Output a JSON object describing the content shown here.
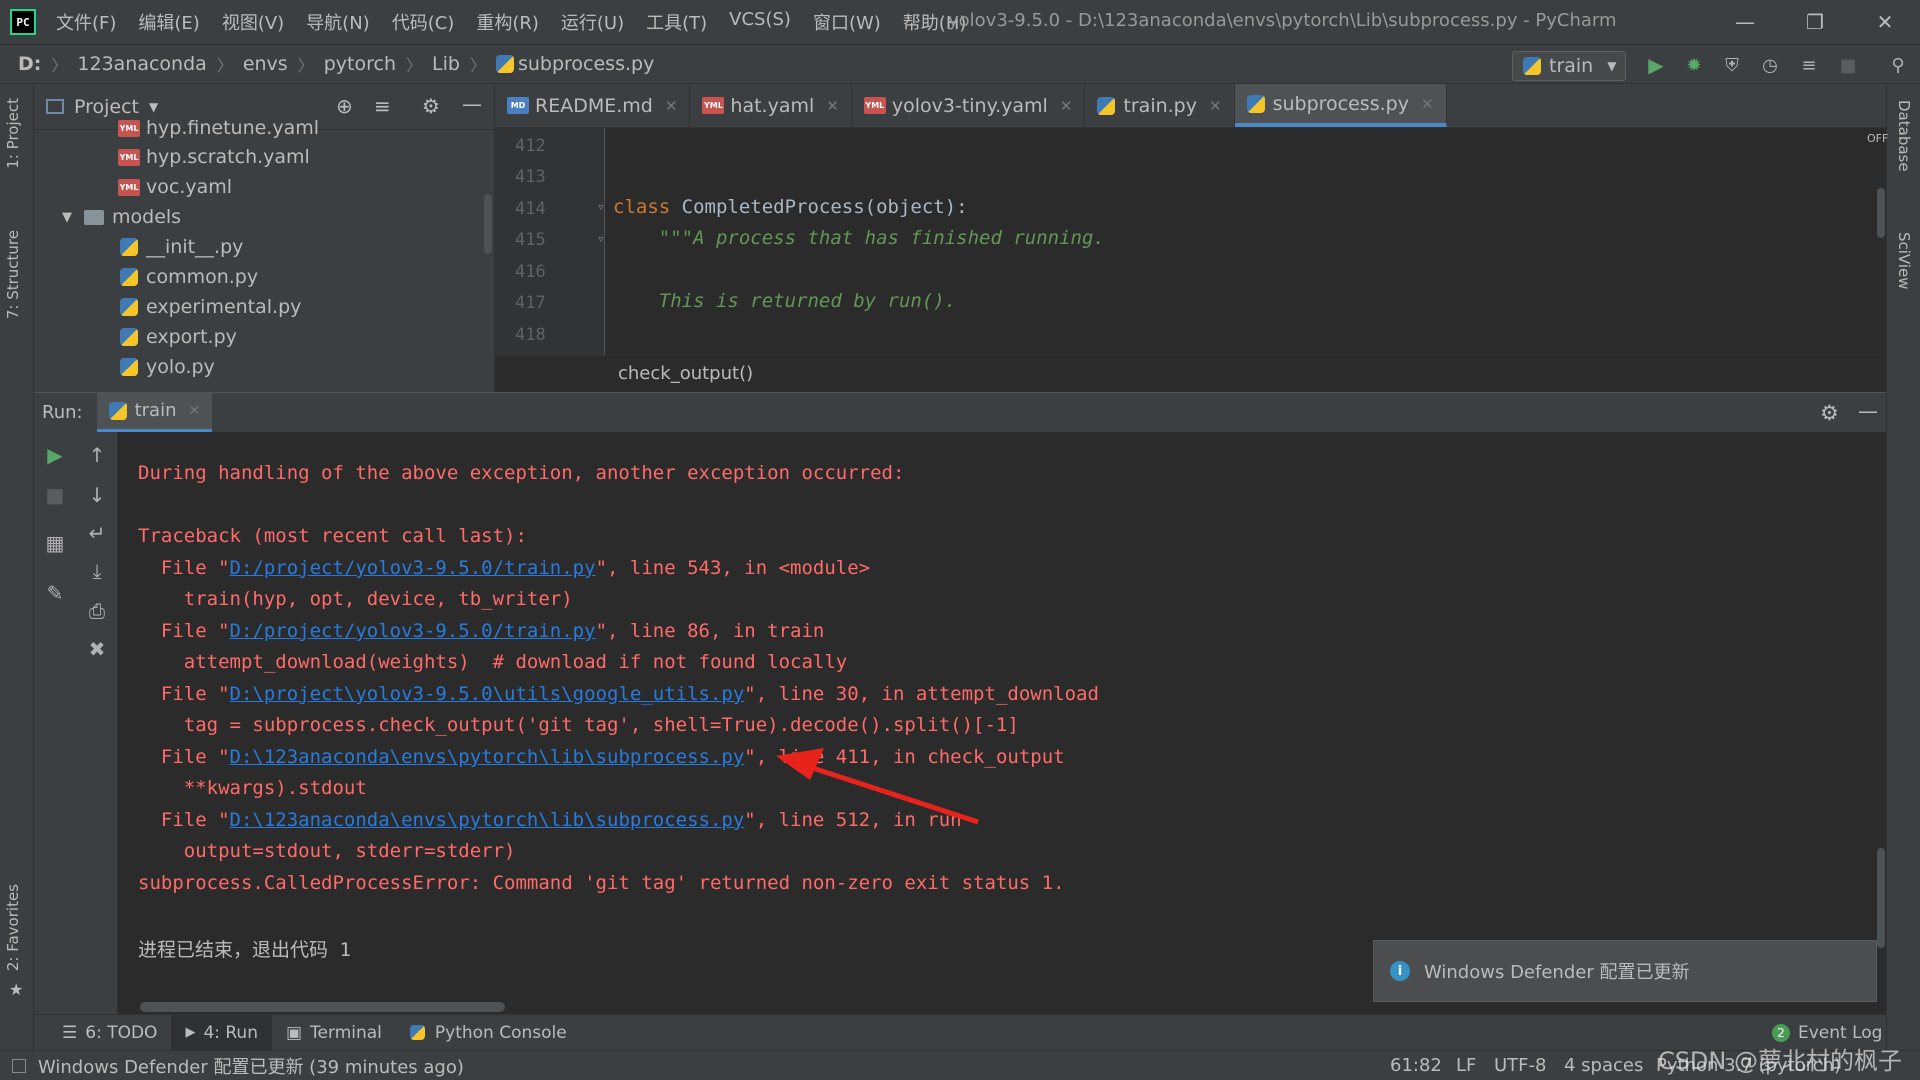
{
  "app": {
    "logo": "PC",
    "menu": [
      "文件(F)",
      "编辑(E)",
      "视图(V)",
      "导航(N)",
      "代码(C)",
      "重构(R)",
      "运行(U)",
      "工具(T)",
      "VCS(S)",
      "窗口(W)",
      "帮助(H)"
    ],
    "window_title": "yolov3-9.5.0 - D:\\123anaconda\\envs\\pytorch\\Lib\\subprocess.py - PyCharm"
  },
  "navbar": {
    "crumbs": [
      "D:",
      "123anaconda",
      "envs",
      "pytorch",
      "Lib",
      "subprocess.py"
    ],
    "run_config": "train"
  },
  "left_strip": {
    "project_tab": "1: Project",
    "structure_tab": "7: Structure",
    "favorites_tab": "2: Favorites"
  },
  "right_strip": {
    "database_tab": "Database",
    "sciview_tab": "SciView",
    "off_label": "OFF"
  },
  "project": {
    "header": "Project",
    "items": [
      {
        "label": "hyp.finetune.yaml",
        "type": "yml"
      },
      {
        "label": "hyp.scratch.yaml",
        "type": "yml"
      },
      {
        "label": "voc.yaml",
        "type": "yml"
      },
      {
        "label": "models",
        "type": "folder"
      },
      {
        "label": "__init__.py",
        "type": "py"
      },
      {
        "label": "common.py",
        "type": "py"
      },
      {
        "label": "experimental.py",
        "type": "py"
      },
      {
        "label": "export.py",
        "type": "py"
      },
      {
        "label": "yolo.py",
        "type": "py"
      }
    ]
  },
  "editor_tabs": [
    {
      "label": "README.md",
      "type": "md"
    },
    {
      "label": "hat.yaml",
      "type": "yml"
    },
    {
      "label": "yolov3-tiny.yaml",
      "type": "yml"
    },
    {
      "label": "train.py",
      "type": "py"
    },
    {
      "label": "subprocess.py",
      "type": "py",
      "active": true
    }
  ],
  "editor": {
    "lines": [
      {
        "num": "412",
        "code": ""
      },
      {
        "num": "413",
        "code": ""
      },
      {
        "num": "414",
        "kw": "class ",
        "code": "CompletedProcess(object):"
      },
      {
        "num": "415",
        "doc": "    \"\"\"A process that has finished running."
      },
      {
        "num": "416",
        "code": ""
      },
      {
        "num": "417",
        "doc": "    This is returned by run()."
      },
      {
        "num": "418",
        "code": ""
      }
    ],
    "breadcrumb": "check_output()"
  },
  "run": {
    "label": "Run:",
    "tab": "train",
    "lines": [
      {
        "text": "During handling of the above exception, another exception occurred:"
      },
      {
        "text": ""
      },
      {
        "text": "Traceback (most recent call last):"
      },
      {
        "pre": "  File \"",
        "link": "D:/project/yolov3-9.5.0/train.py",
        "post": "\", line 543, in <module>"
      },
      {
        "text": "    train(hyp, opt, device, tb_writer)"
      },
      {
        "pre": "  File \"",
        "link": "D:/project/yolov3-9.5.0/train.py",
        "post": "\", line 86, in train"
      },
      {
        "text": "    attempt_download(weights)  # download if not found locally"
      },
      {
        "pre": "  File \"",
        "link": "D:\\project\\yolov3-9.5.0\\utils\\google_utils.py",
        "post": "\", line 30, in attempt_download"
      },
      {
        "text": "    tag = subprocess.check_output('git tag', shell=True).decode().split()[-1]"
      },
      {
        "pre": "  File \"",
        "link": "D:\\123anaconda\\envs\\pytorch\\lib\\subprocess.py",
        "post": "\", line 411, in check_output"
      },
      {
        "text": "    **kwargs).stdout"
      },
      {
        "pre": "  File \"",
        "link": "D:\\123anaconda\\envs\\pytorch\\lib\\subprocess.py",
        "post": "\", line 512, in run"
      },
      {
        "text": "    output=stdout, stderr=stderr)"
      },
      {
        "text": "subprocess.CalledProcessError: Command 'git tag' returned non-zero exit status 1."
      },
      {
        "text": ""
      },
      {
        "text": "进程已结束，退出代码 1",
        "normal": true
      }
    ]
  },
  "notification": "Windows Defender 配置已更新",
  "bottom_tabs": [
    {
      "label": "6: TODO"
    },
    {
      "label": "4: Run",
      "active": true
    },
    {
      "label": "Terminal"
    },
    {
      "label": "Python Console"
    }
  ],
  "event_log": {
    "count": "2",
    "label": "Event Log"
  },
  "status": {
    "message": "Windows Defender 配置已更新 (39 minutes ago)",
    "position": "61:82",
    "line_sep": "LF",
    "encoding": "UTF-8",
    "indent": "4 spaces",
    "interpreter": "Python 3.7 (pytorch)"
  },
  "watermark": "CSDN @萝北村的枫子",
  "colors": {
    "error": "#ff6b68",
    "link": "#287bde",
    "arrow": "#e8231c",
    "accent": "#4a88c7"
  }
}
